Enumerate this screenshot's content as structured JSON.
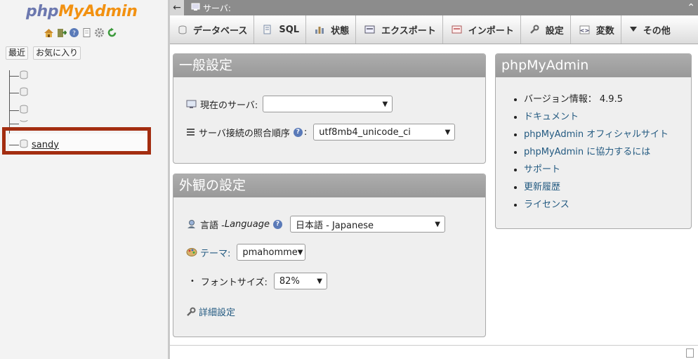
{
  "sidebar": {
    "logo_php": "php",
    "logo_myadmin": "MyAdmin",
    "icons": [
      "home-icon",
      "logout-icon",
      "help-icon",
      "docs-icon",
      "settings-icon",
      "reload-icon"
    ],
    "recent_label": "最近",
    "favorites_label": "お気に入り",
    "databases": [
      "",
      "",
      "",
      "",
      "sandy"
    ]
  },
  "topbar": {
    "server_label": "サーバ:"
  },
  "tabs": [
    {
      "label": "データベース",
      "icon": "database-icon"
    },
    {
      "label": "SQL",
      "icon": "sql-icon"
    },
    {
      "label": "状態",
      "icon": "status-icon"
    },
    {
      "label": "エクスポート",
      "icon": "export-icon"
    },
    {
      "label": "インポート",
      "icon": "import-icon"
    },
    {
      "label": "設定",
      "icon": "wrench-icon"
    },
    {
      "label": "変数",
      "icon": "variables-icon"
    },
    {
      "label": "その他",
      "icon": "more-icon"
    }
  ],
  "general": {
    "title": "一般設定",
    "server_label": "現在のサーバ:",
    "server_value": "",
    "collation_label": "サーバ接続の照合順序",
    "collation_value": "utf8mb4_unicode_ci"
  },
  "appearance": {
    "title": "外観の設定",
    "language_label": "言語 - ",
    "language_label_en": "Language",
    "language_value": "日本語 - Japanese",
    "theme_label": "テーマ:",
    "theme_value": "pmahomme",
    "fontsize_label": "フォントサイズ:",
    "fontsize_value": "82%",
    "more_settings": "詳細設定"
  },
  "info": {
    "title": "phpMyAdmin",
    "version_label": "バージョン情報：",
    "version_value": "4.9.5",
    "links": [
      "ドキュメント",
      "phpMyAdmin オフィシャルサイト",
      "phpMyAdmin に協力するには",
      "サポート",
      "更新履歴",
      "ライセンス"
    ]
  }
}
